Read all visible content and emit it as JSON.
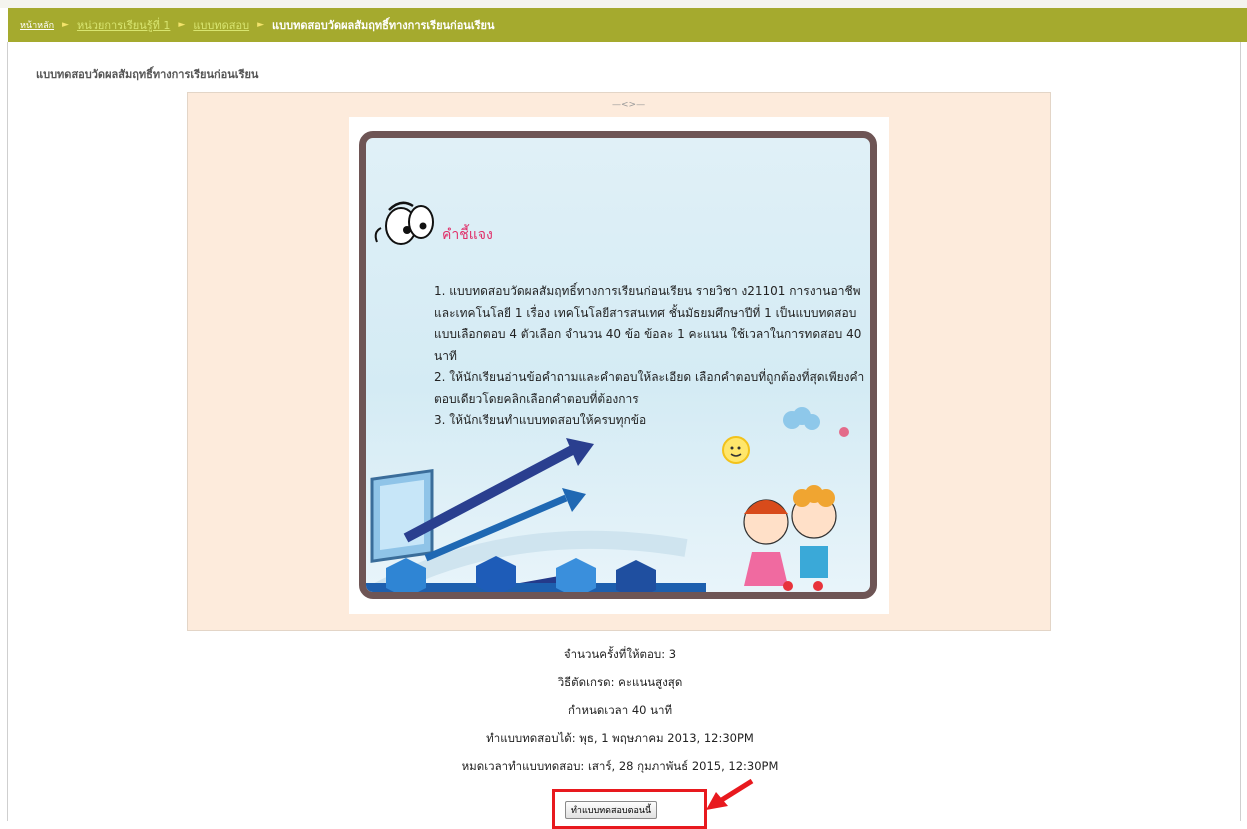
{
  "breadcrumb": {
    "home": "หน้าหลัก",
    "items": [
      "หน่วยการเรียนรู้ที่ 1",
      "แบบทดสอบ"
    ],
    "current": "แบบทดสอบวัดผลสัมฤทธิ์ทางการเรียนก่อนเรียน"
  },
  "page_title": "แบบทดสอบวัดผลสัมฤทธิ์ทางการเรียนก่อนเรียน",
  "instructions": {
    "heading": "คำชี้แจง",
    "item1": "1. แบบทดสอบวัดผลสัมฤทธิ์ทางการเรียนก่อนเรียน รายวิชา ง21101 การงานอาชีพและเทคโนโลยี 1 เรื่อง เทคโนโลยีสารสนเทศ ชั้นมัธยมศึกษาปีที่ 1 เป็นแบบทดสอบแบบเลือกตอบ 4 ตัวเลือก จำนวน 40 ข้อ ข้อละ 1 คะแนน ใช้เวลาในการทดสอบ 40 นาที",
    "item2": "2. ให้นักเรียนอ่านข้อคำถามและคำตอบให้ละเอียด เลือกคำตอบที่ถูกต้องที่สุดเพียงคำตอบเดียวโดยคลิกเลือกคำตอบที่ต้องการ",
    "item3": "3. ให้นักเรียนทำแบบทดสอบให้ครบทุกข้อ"
  },
  "quiz_info": {
    "attempts": "จำนวนครั้งที่ให้ตอบ: 3",
    "grading": "วิธีตัดเกรด: คะแนนสูงสุด",
    "time_limit": "กำหนดเวลา 40 นาที",
    "opens": "ทำแบบทดสอบได้: พุธ, 1 พฤษภาคม 2013, 12:30PM",
    "closes": "หมดเวลาทำแบบทดสอบ: เสาร์, 28 กุมภาพันธ์ 2015, 12:30PM"
  },
  "start_button": "ทำแบบทดสอบตอนนี้",
  "colors": {
    "navbar": "#a5aa2e",
    "intro_bg": "#fdebdc",
    "heading": "#e0306a",
    "highlight": "#e8191e"
  }
}
